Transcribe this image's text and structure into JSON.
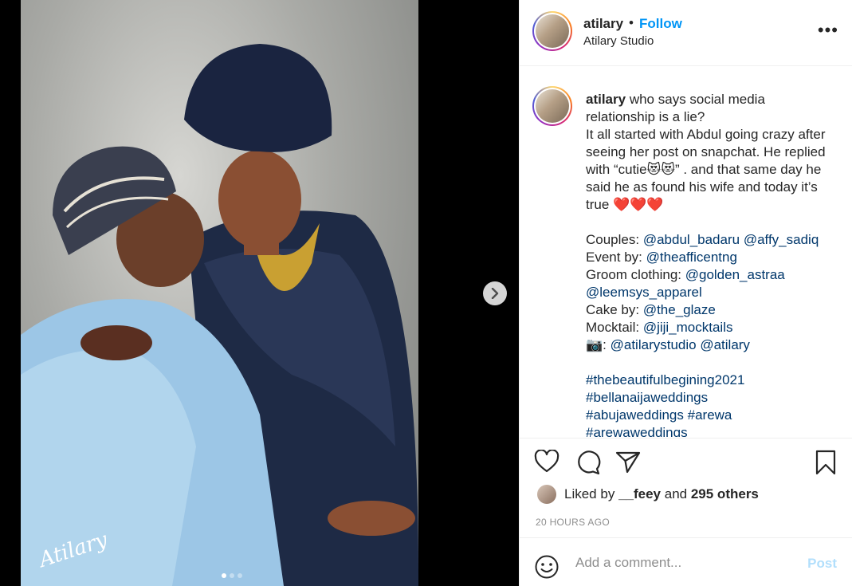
{
  "media": {
    "watermark": "Atilary",
    "slide_count": 3,
    "active_slide": 1,
    "next_icon": "chevron-right-icon"
  },
  "header": {
    "username": "atilary",
    "separator": "•",
    "follow_label": "Follow",
    "location": "Atilary Studio",
    "more_icon": "more-horizontal-icon"
  },
  "caption": {
    "username": "atilary",
    "lines": [
      "who says social media relationship is a lie?",
      "It all started with Abdul going crazy after seeing her post on snapchat. He replied with “cutie😻😻” . and that same day he said he as found his wife and today it’s true ❤️❤️❤️"
    ],
    "couples_label": "Couples:",
    "couples": [
      "@abdul_badaru",
      "@affy_sadiq"
    ],
    "event_label": "Event by:",
    "event": "@theafficentng",
    "groom_label": "Groom clothing:",
    "groom": [
      "@golden_astraa",
      "@leemsys_apparel"
    ],
    "cake_label": "Cake by:",
    "cake": "@the_glaze",
    "mocktail_label": "Mocktail:",
    "mocktail": "@jiji_mocktails",
    "camera_label": "📷:",
    "camera": [
      "@atilarystudio",
      "@atilary"
    ],
    "hashtags": [
      "#thebeautifulbegining2021",
      "#bellanaijaweddings",
      "#abujaweddings",
      "#arewa",
      "#arewaweddings"
    ]
  },
  "actions": {
    "icons": [
      "heart-icon",
      "comment-icon",
      "share-icon",
      "bookmark-icon"
    ],
    "liked_by_prefix": "Liked by",
    "liked_by_user": "__feey",
    "liked_by_and": "and",
    "liked_by_others": "295 others",
    "timestamp": "20 HOURS AGO"
  },
  "comment": {
    "placeholder": "Add a comment...",
    "post_label": "Post"
  },
  "colors": {
    "link": "#0095f6",
    "mention": "#00376b",
    "post_disabled": "#b2dffc",
    "muted": "#8e8e8e"
  }
}
